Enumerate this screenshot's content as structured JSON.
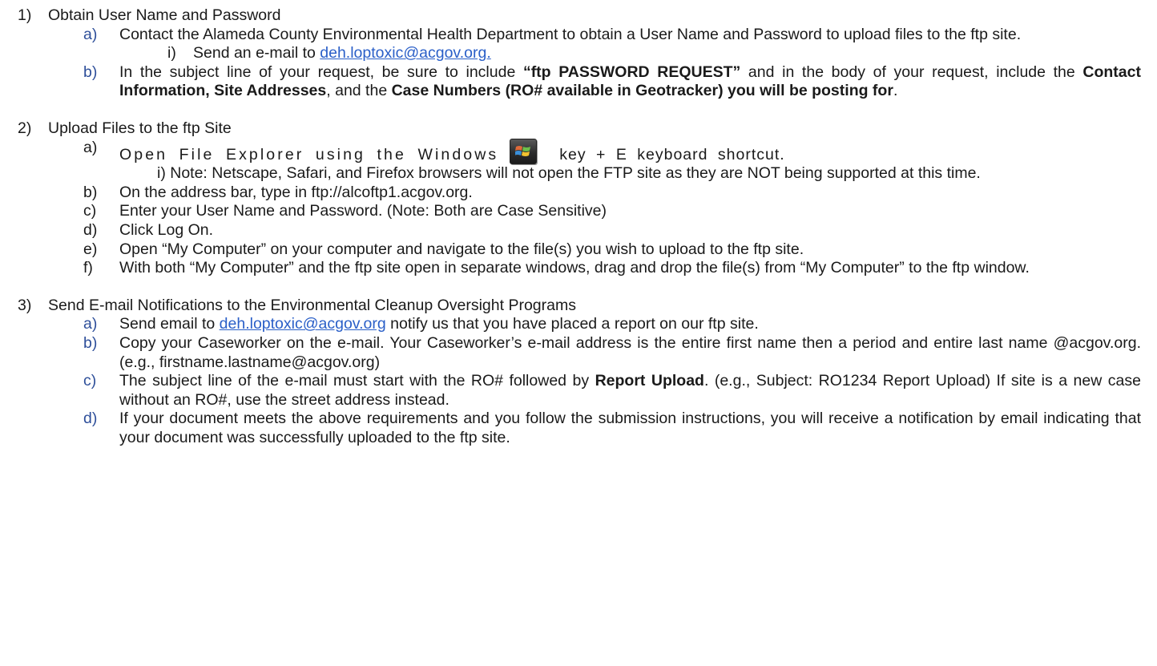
{
  "sections": [
    {
      "number": "1)",
      "title": "Obtain User Name and Password",
      "items": [
        {
          "marker": "a)",
          "text_before": "Contact the Alameda County Environmental Health Department to obtain a User Name and Password to upload files to the ftp site.",
          "note_marker": "i)",
          "note_text": "Send an e-mail to",
          "note_link": "deh.loptoxic@acgov.org."
        },
        {
          "marker": "b)",
          "part1": "In the subject line of your request, be sure to include ",
          "bold1": "“ftp PASSWORD REQUEST”",
          "part2": " and in the body of your request, include the ",
          "bold2": "Contact Information, Site Addresses",
          "part3": ", and the ",
          "bold3": "Case Numbers (RO# available in Geotracker) you will be posting for",
          "part4": "."
        }
      ]
    },
    {
      "number": "2)",
      "title": "Upload Files to the ftp Site",
      "items": [
        {
          "marker": "a)",
          "text_before": "Open File Explorer using the Windows",
          "icon": "windows-key-icon",
          "text_after": "key + E keyboard shortcut.",
          "note_text": "i) Note: Netscape, Safari, and Firefox browsers will not open the FTP site as they are NOT being supported at this time."
        },
        {
          "marker": "b)",
          "text": "On the address bar, type in  ftp://alcoftp1.acgov.org."
        },
        {
          "marker": "c)",
          "text": "Enter your User Name and Password. (Note: Both are Case Sensitive)"
        },
        {
          "marker": "d)",
          "text": "Click Log On."
        },
        {
          "marker": "e)",
          "text": "Open “My Computer” on your computer and navigate to the file(s) you wish to upload to the ftp site."
        },
        {
          "marker": "f)",
          "text": "With both “My Computer” and the ftp site open in separate windows, drag and drop the file(s) from “My Computer” to the ftp window."
        }
      ]
    },
    {
      "number": "3)",
      "title": "Send E-mail Notifications to the Environmental Cleanup Oversight Programs",
      "items": [
        {
          "marker": "a)",
          "text_before": "Send email to ",
          "link": "deh.loptoxic@acgov.org",
          "text_after": " notify us that you have placed a report on our ftp site."
        },
        {
          "marker": "b)",
          "text": "Copy your Caseworker on the e-mail.  Your Caseworker’s e-mail address is the entire first name then a period and entire last name @acgov.org.  (e.g., firstname.lastname@acgov.org)"
        },
        {
          "marker": "c)",
          "text_before": "The subject line of the e-mail must start with the RO# followed by ",
          "bold": "Report Upload",
          "text_after": ".  (e.g., Subject: RO1234 Report Upload)  If site is a new case without an RO#, use the street address instead."
        },
        {
          "marker": "d)",
          "text": "If your document meets the above requirements and you follow the submission instructions, you will receive a notification by email indicating that your document was successfully uploaded to the ftp site."
        }
      ]
    }
  ],
  "colors": {
    "link": "#2a5fc8",
    "marker_blue": "#2e4f9a",
    "text": "#1a1a1a"
  }
}
